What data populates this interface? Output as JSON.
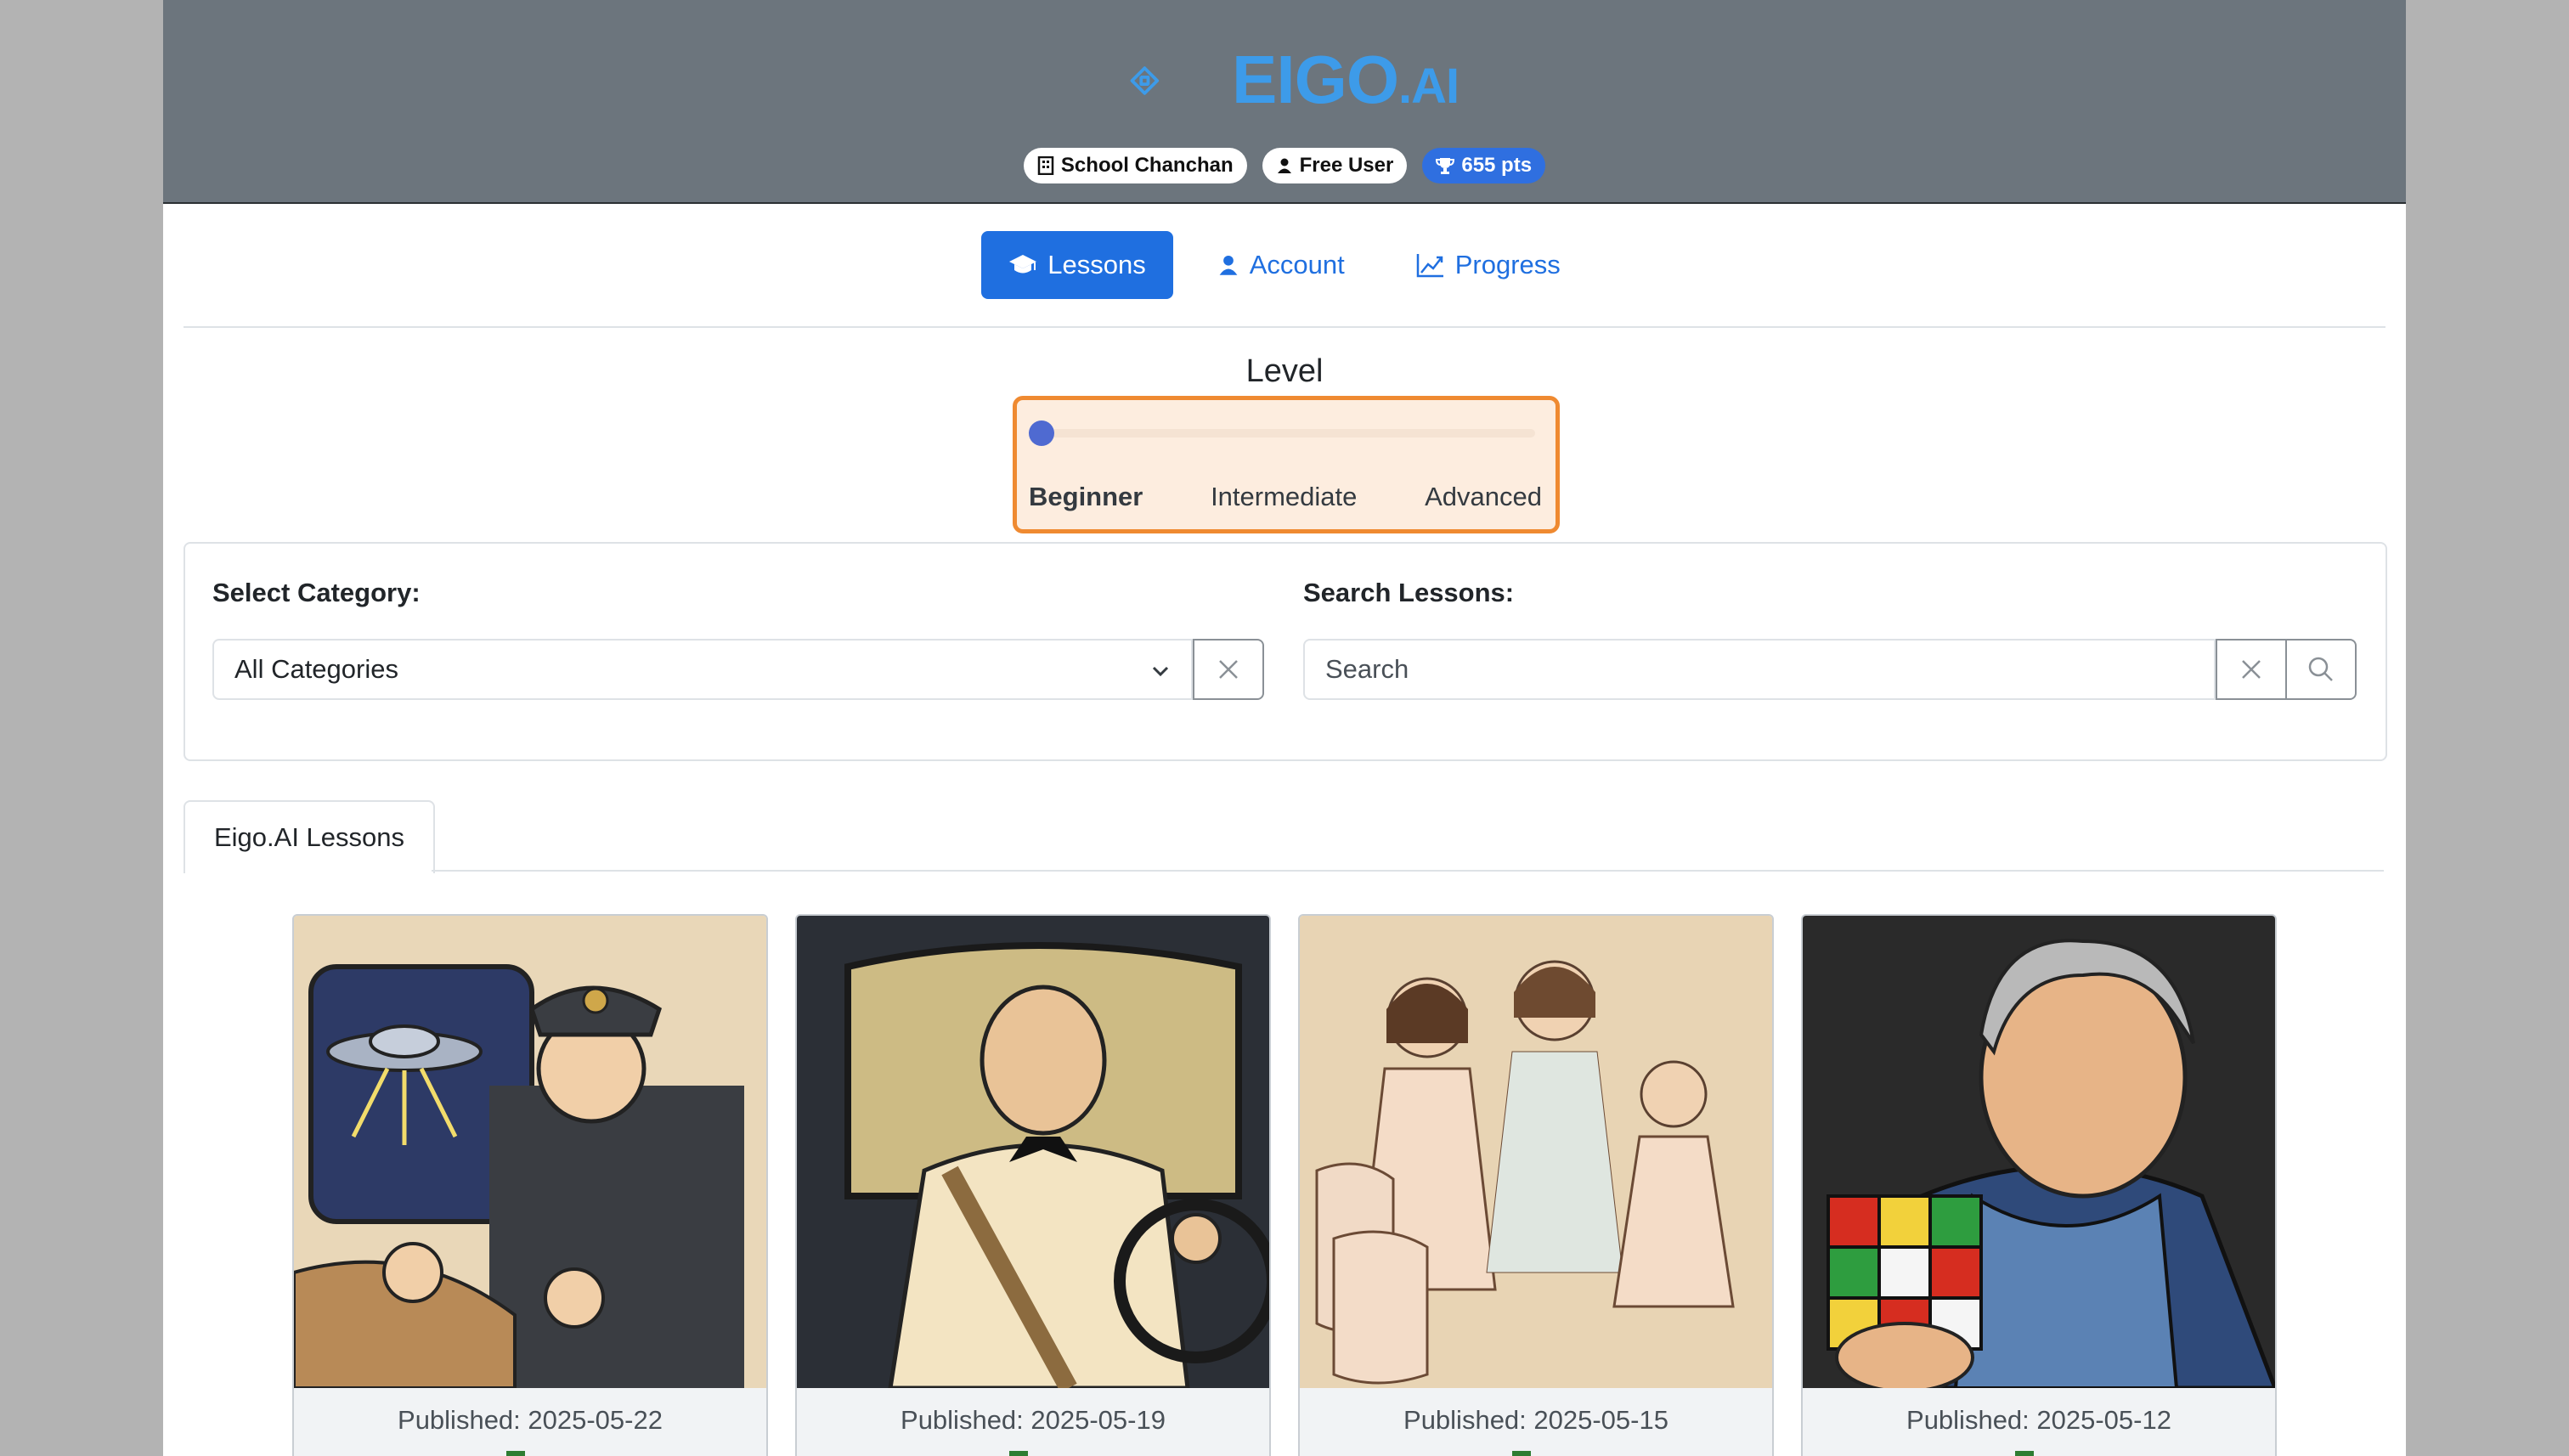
{
  "brand": {
    "name": "EIGO",
    "suffix": ".AI"
  },
  "badges": {
    "school": "School Chanchan",
    "user": "Free User",
    "points": "655 pts"
  },
  "nav": {
    "lessons": "Lessons",
    "account": "Account",
    "progress": "Progress"
  },
  "level": {
    "title": "Level",
    "value": 0,
    "options": [
      "Beginner",
      "Intermediate",
      "Advanced"
    ],
    "selected": "Beginner"
  },
  "filters": {
    "category_label": "Select Category:",
    "category_value": "All Categories",
    "search_label": "Search Lessons:",
    "search_placeholder": "Search"
  },
  "tabs": {
    "eigo_lessons": "Eigo.AI Lessons"
  },
  "lessons": [
    {
      "published": "Published: 2025-05-22"
    },
    {
      "published": "Published: 2025-05-19"
    },
    {
      "published": "Published: 2025-05-15"
    },
    {
      "published": "Published: 2025-05-12"
    }
  ],
  "colors": {
    "primary": "#1f6fe0",
    "header_bg": "#6c757d",
    "logo": "#3d9be9",
    "highlight": "#ef8a31",
    "slider_thumb": "#4f6ad1"
  }
}
